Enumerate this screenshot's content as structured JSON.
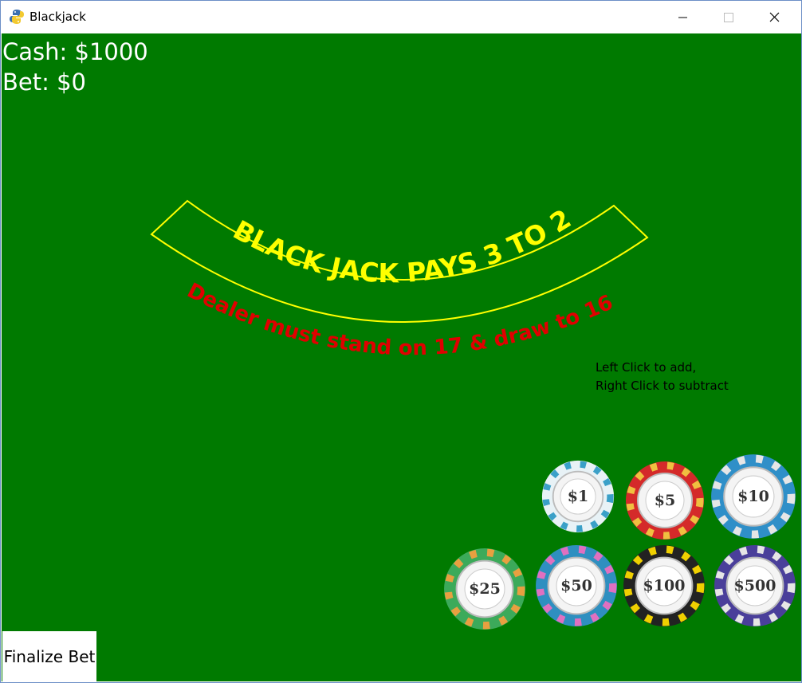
{
  "window": {
    "title": "Blackjack",
    "icon": "python-snake-icon",
    "controls": [
      "minimize-icon",
      "maximize-icon",
      "close-icon"
    ]
  },
  "hud": {
    "cash": "Cash: $1000",
    "bet": "Bet: $0"
  },
  "table": {
    "felt_color": "#007a00",
    "arc_text": "BLACK JACK PAYS 3 TO 2",
    "arc_text_color": "#ffff00",
    "rule_text": "Dealer must stand on 17 & draw to 16",
    "rule_text_color": "#e00000"
  },
  "help": {
    "line1": "Left Click to add,",
    "line2": "Right Click to subtract"
  },
  "chips": [
    {
      "label": "$1",
      "color": "#e8f2f6",
      "accent": "#3aa0c8"
    },
    {
      "label": "$5",
      "color": "#d42a2a",
      "accent": "#f0c040"
    },
    {
      "label": "$10",
      "color": "#2f8fc8",
      "accent": "#e6e6e6"
    },
    {
      "label": "$25",
      "color": "#3caa5a",
      "accent": "#e8a040"
    },
    {
      "label": "$50",
      "color": "#2f8fc0",
      "accent": "#e070c0"
    },
    {
      "label": "$100",
      "color": "#222222",
      "accent": "#f0d000"
    },
    {
      "label": "$500",
      "color": "#4a3f9a",
      "accent": "#e6e6e6"
    }
  ],
  "finalize_label": "Finalize Bet"
}
